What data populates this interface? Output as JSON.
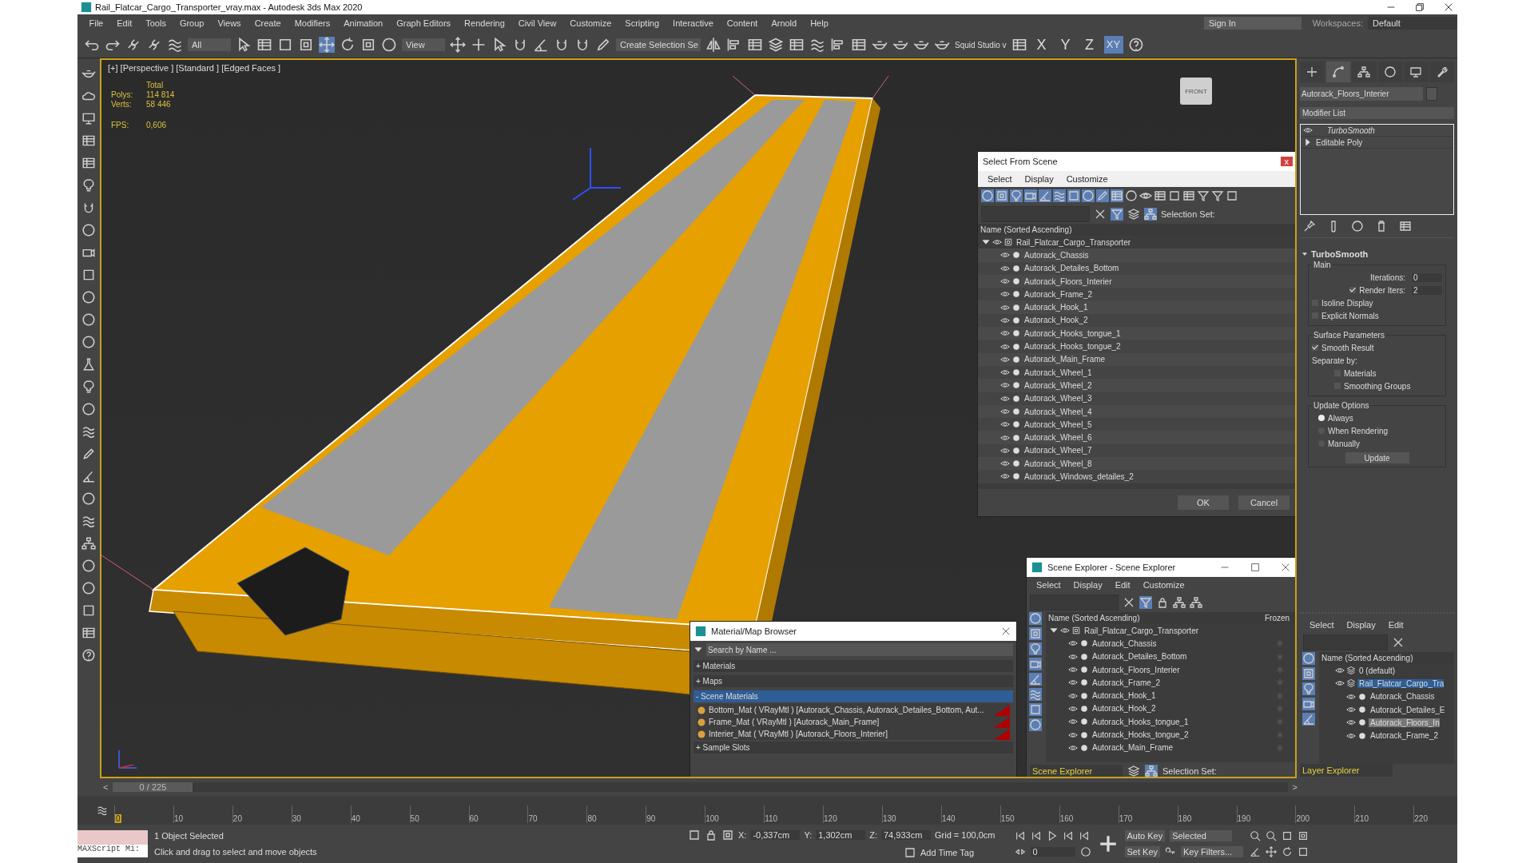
{
  "window": {
    "title": "Rail_Flatcar_Cargo_Transporter_vray.max - Autodesk 3ds Max 2020"
  },
  "menu": [
    "File",
    "Edit",
    "Tools",
    "Group",
    "Views",
    "Create",
    "Modifiers",
    "Animation",
    "Graph Editors",
    "Rendering",
    "Civil View",
    "Customize",
    "Scripting",
    "Interactive",
    "Content",
    "Arnold",
    "Help"
  ],
  "sign_in": "Sign In",
  "workspaces": {
    "label": "Workspaces:",
    "value": "Default"
  },
  "toolbar": {
    "selection_filter": "All",
    "reference_coord": "View",
    "selection_set": "Create Selection Se",
    "plugin": "Squid Studio v",
    "axis_buttons": [
      {
        "label": "X",
        "selected": false
      },
      {
        "label": "Y",
        "selected": false
      },
      {
        "label": "Z",
        "selected": false
      },
      {
        "label": "XY",
        "selected": true
      }
    ]
  },
  "viewport": {
    "label": "[+] [Perspective ] [Standard ] [Edged Faces ]",
    "stats_header": "Total",
    "stats": [
      {
        "label": "Polys:",
        "value": "114 814"
      },
      {
        "label": "Verts:",
        "value": "58 446"
      }
    ],
    "fps_label": "FPS:",
    "fps": "0,606",
    "view_cube": "FRONT"
  },
  "command_panel": {
    "tabs": [
      {
        "kind": "create",
        "selected": false
      },
      {
        "kind": "modify",
        "selected": true
      },
      {
        "kind": "hierarchy",
        "selected": false
      },
      {
        "kind": "motion",
        "selected": false
      },
      {
        "kind": "display",
        "selected": false
      },
      {
        "kind": "utilities",
        "selected": false
      }
    ],
    "object_name": "Autorack_Floors_Interier",
    "modifier_list": "Modifier List",
    "stack": [
      {
        "name": "TurboSmooth",
        "kind": "modifier"
      },
      {
        "name": "Editable Poly",
        "kind": "base"
      }
    ],
    "rollout": {
      "title": "TurboSmooth",
      "main": {
        "title": "Main",
        "iterations": {
          "label": "Iterations:",
          "value": "0"
        },
        "render_iters": {
          "label": "Render Iters:",
          "value": "2",
          "checked": true
        },
        "isoline": {
          "label": "Isoline Display",
          "checked": false
        },
        "explicit_normals": {
          "label": "Explicit Normals",
          "checked": false
        }
      },
      "surface": {
        "title": "Surface Parameters",
        "smooth_result": {
          "label": "Smooth Result",
          "checked": true
        },
        "separate_by": "Separate by:",
        "materials": {
          "label": "Materials",
          "checked": false
        },
        "smoothing_groups": {
          "label": "Smoothing Groups",
          "checked": false
        }
      },
      "update": {
        "title": "Update Options",
        "options": [
          {
            "label": "Always",
            "selected": true
          },
          {
            "label": "When Rendering",
            "selected": false
          },
          {
            "label": "Manually",
            "selected": false
          }
        ],
        "button": "Update"
      }
    }
  },
  "select_from_scene": {
    "title": "Select From Scene",
    "close": "x",
    "menu": [
      "Select",
      "Display",
      "Customize"
    ],
    "selection_set": "Selection Set:",
    "column": "Name (Sorted Ascending)",
    "root": "Rail_Flatcar_Cargo_Transporter",
    "items": [
      "Autorack_Chassis",
      "Autorack_Detailes_Bottom",
      "Autorack_Floors_Interier",
      "Autorack_Frame_2",
      "Autorack_Hook_1",
      "Autorack_Hook_2",
      "Autorack_Hooks_tongue_1",
      "Autorack_Hooks_tongue_2",
      "Autorack_Main_Frame",
      "Autorack_Wheel_1",
      "Autorack_Wheel_2",
      "Autorack_Wheel_3",
      "Autorack_Wheel_4",
      "Autorack_Wheel_5",
      "Autorack_Wheel_6",
      "Autorack_Wheel_7",
      "Autorack_Wheel_8",
      "Autorack_Windows_detailes_2"
    ],
    "buttons": [
      "OK",
      "Cancel"
    ]
  },
  "material_browser": {
    "title": "Material/Map Browser",
    "placeholder": "Search by Name ...",
    "groups": [
      {
        "sign": "+",
        "label": "Materials",
        "expanded": false
      },
      {
        "sign": "+",
        "label": "Maps",
        "expanded": false
      },
      {
        "sign": "-",
        "label": "Scene Materials",
        "expanded": true,
        "items": [
          "Bottom_Mat  ( VRayMtl ) [Autorack_Chassis, Autorack_Detailes_Bottom, Aut...",
          "Frame_Mat  ( VRayMtl ) [Autorack_Main_Frame]",
          "Interier_Mat  ( VRayMtl ) [Autorack_Floors_Interier]"
        ]
      },
      {
        "sign": "+",
        "label": "Sample Slots",
        "expanded": false
      }
    ]
  },
  "scene_explorer": {
    "title": "Scene Explorer - Scene Explorer",
    "menu": [
      "Select",
      "Display",
      "Edit",
      "Customize"
    ],
    "columns": [
      "Name (Sorted Ascending)",
      "Frozen"
    ],
    "root": "Rail_Flatcar_Cargo_Transporter",
    "items": [
      "Autorack_Chassis",
      "Autorack_Detailes_Bottom",
      "Autorack_Floors_Interier",
      "Autorack_Frame_2",
      "Autorack_Hook_1",
      "Autorack_Hook_2",
      "Autorack_Hooks_tongue_1",
      "Autorack_Hooks_tongue_2",
      "Autorack_Main_Frame"
    ],
    "explorer_name": "Scene Explorer",
    "selection_set": "Selection Set:"
  },
  "layer_explorer": {
    "menu": [
      "Select",
      "Display",
      "Edit"
    ],
    "column": "Name (Sorted Ascending)",
    "layers": [
      {
        "name": "0 (default)",
        "selected": false
      },
      {
        "name": "Rail_Flatcar_Cargo_Tra",
        "selected": true,
        "children": [
          {
            "name": "Autorack_Chassis",
            "selected": false
          },
          {
            "name": "Autorack_Detailes_E",
            "selected": false
          },
          {
            "name": "Autorack_Floors_In",
            "selected": true
          },
          {
            "name": "Autorack_Frame_2",
            "selected": false
          }
        ]
      }
    ],
    "explorer_name": "Layer Explorer"
  },
  "timeline": {
    "frame": "0 / 225",
    "level": 0,
    "prev": "<",
    "next": ">",
    "ticks": [
      "0",
      "10",
      "20",
      "30",
      "40",
      "50",
      "60",
      "70",
      "80",
      "90",
      "100",
      "110",
      "120",
      "130",
      "140",
      "150",
      "160",
      "170",
      "180",
      "190",
      "200",
      "210",
      "220"
    ]
  },
  "status": {
    "maxscript": "MAXScript Mi:",
    "selected": "1 Object Selected",
    "prompt": "Click and drag to select and move objects",
    "coords": [
      {
        "label": "X:",
        "value": "-0,337cm"
      },
      {
        "label": "Y:",
        "value": "1,302cm"
      },
      {
        "label": "Z:",
        "value": "74,933cm"
      }
    ],
    "grid": "Grid = 100,0cm",
    "add_time_tag": "Add Time Tag",
    "auto_key": "Auto Key",
    "set_key": "Set Key",
    "key_mode": "Selected",
    "key_filters": "Key Filters...",
    "frame": "0"
  }
}
